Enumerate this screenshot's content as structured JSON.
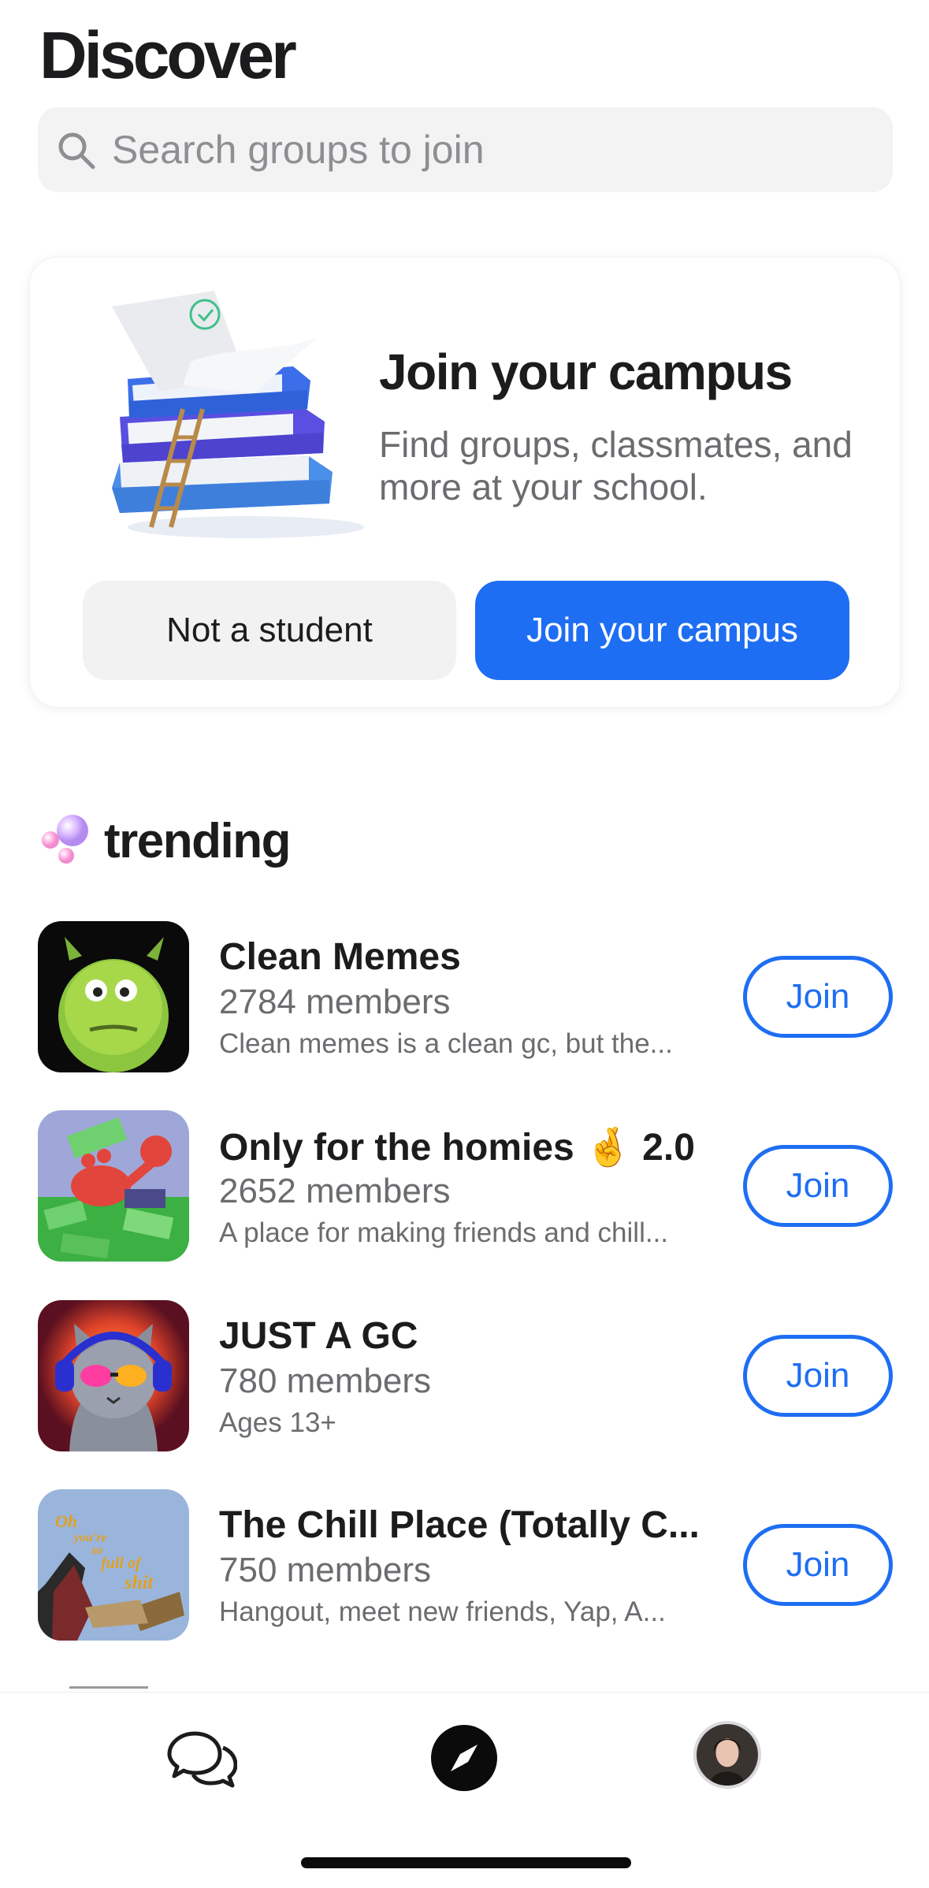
{
  "header": {
    "title": "Discover"
  },
  "search": {
    "placeholder": "Search groups to join",
    "value": ""
  },
  "campus_card": {
    "title": "Join your campus",
    "subtitle": "Find groups, classmates, and more at your school.",
    "secondary_label": "Not a student",
    "primary_label": "Join your campus"
  },
  "trending": {
    "label": "trending",
    "groups": [
      {
        "name": "Clean Memes",
        "members": "2784 members",
        "description": "Clean memes is a clean gc, but the...",
        "join_label": "Join"
      },
      {
        "name": "Only for the homies 🤞 2.0",
        "members": "2652 members",
        "description": "A place for making friends and chill...",
        "join_label": "Join"
      },
      {
        "name": "JUST A GC",
        "members": "780 members",
        "description": "Ages 13+",
        "join_label": "Join"
      },
      {
        "name": "The Chill Place (Totally C...",
        "members": "750 members",
        "description": "Hangout, meet new friends, Yap, A...",
        "join_label": "Join"
      }
    ]
  },
  "thumb_texts": {
    "oh": "Oh",
    "youre": "you're",
    "so": "so",
    "fullof": "full of",
    "shit": "shit"
  },
  "tab_bar": {
    "items": [
      "chats-icon",
      "discover-compass-icon",
      "profile-avatar"
    ]
  },
  "colors": {
    "accent": "#1e6ef3",
    "text": "#1c1c1e",
    "secondary_text": "#6c6c70",
    "surface": "#f3f3f4"
  }
}
